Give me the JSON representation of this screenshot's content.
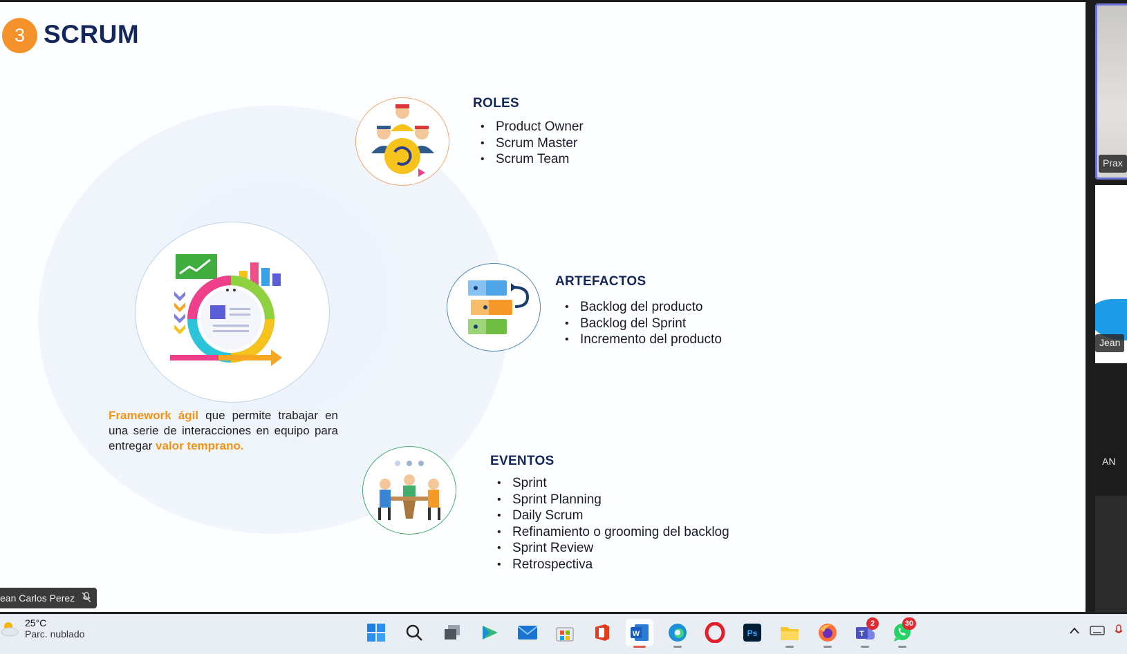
{
  "slide": {
    "number": "3",
    "title": "SCRUM",
    "roles": {
      "heading": "ROLES",
      "items": [
        "Product Owner",
        "Scrum Master",
        "Scrum Team"
      ]
    },
    "artefactos": {
      "heading": "ARTEFACTOS",
      "items": [
        "Backlog del producto",
        "Backlog del Sprint",
        "Incremento del producto"
      ]
    },
    "eventos": {
      "heading": "EVENTOS",
      "items": [
        "Sprint",
        "Sprint Planning",
        "Daily Scrum",
        "Refinamiento o grooming del backlog",
        "Sprint Review",
        "Retrospectiva"
      ]
    },
    "description": {
      "highlight1": "Framework ágil",
      "text1": " que permite trabajar en una serie de interacciones en equipo para entregar ",
      "highlight2": "valor temprano."
    },
    "accent_color": "#f3922a",
    "title_color": "#13275a"
  },
  "presenter_chip": {
    "name": "ean Carlos Perez",
    "icon": "mic-off-icon"
  },
  "participants": [
    {
      "label": "Prax",
      "icon": "video-tile"
    },
    {
      "label": "Jean",
      "icon": "video-tile"
    },
    {
      "label": "AN",
      "icon": "avatar"
    }
  ],
  "taskbar": {
    "weather": {
      "temp": "25°C",
      "condition": "Parc. nublado",
      "icon": "partly-cloudy-icon"
    },
    "apps": [
      {
        "name": "start-button",
        "icon": "windows-icon"
      },
      {
        "name": "search-button",
        "icon": "search-icon"
      },
      {
        "name": "task-view-button",
        "icon": "task-view-icon"
      },
      {
        "name": "app-generic",
        "icon": "play-icon"
      },
      {
        "name": "mail-app",
        "icon": "mail-icon"
      },
      {
        "name": "store-app",
        "icon": "store-icon"
      },
      {
        "name": "office-app",
        "icon": "office-icon"
      },
      {
        "name": "word-app",
        "icon": "word-icon"
      },
      {
        "name": "edge-app",
        "icon": "edge-icon"
      },
      {
        "name": "opera-app",
        "icon": "opera-icon"
      },
      {
        "name": "photoshop-app",
        "icon": "photoshop-icon"
      },
      {
        "name": "file-explorer-app",
        "icon": "folder-icon"
      },
      {
        "name": "firefox-app",
        "icon": "firefox-icon"
      },
      {
        "name": "teams-app",
        "icon": "teams-icon",
        "badge": "2"
      },
      {
        "name": "whatsapp-app",
        "icon": "whatsapp-icon",
        "badge": "30"
      }
    ],
    "ps_label": "Ps",
    "word_label": "W",
    "teams_label": "T"
  }
}
